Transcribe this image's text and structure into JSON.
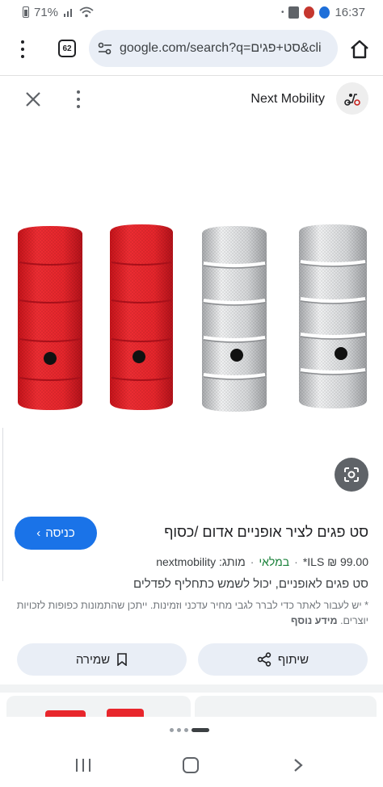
{
  "status_bar": {
    "battery": "71%",
    "time": "16:37"
  },
  "browser": {
    "tab_count": "62",
    "url": "google.com/search?q=סט+פגים&cli"
  },
  "viewer": {
    "site_name": "Next Mobility"
  },
  "product": {
    "visit_label": "כניסה",
    "title": "סט פגים לציר אופניים אדום /כסוף",
    "price": "99.00 ₪ ILS*",
    "stock": "במלאי",
    "brand": "מותג: nextmobility",
    "description": "סט פגים לאופניים, יכול לשמש כתחליף לפדלים",
    "disclaimer": "* יש לעבור לאתר כדי לברר לגבי מחיר עדכני וזמינות. ייתכן שהתמונות כפופות לזכויות יוצרים.",
    "more_info": "מידע נוסף"
  },
  "actions": {
    "share_label": "שיתוף",
    "save_label": "שמירה"
  },
  "colors": {
    "red_peg": "#e8262c",
    "silver_peg": "#d9dadc",
    "accent": "#1a73e8",
    "in_stock": "#188038"
  }
}
